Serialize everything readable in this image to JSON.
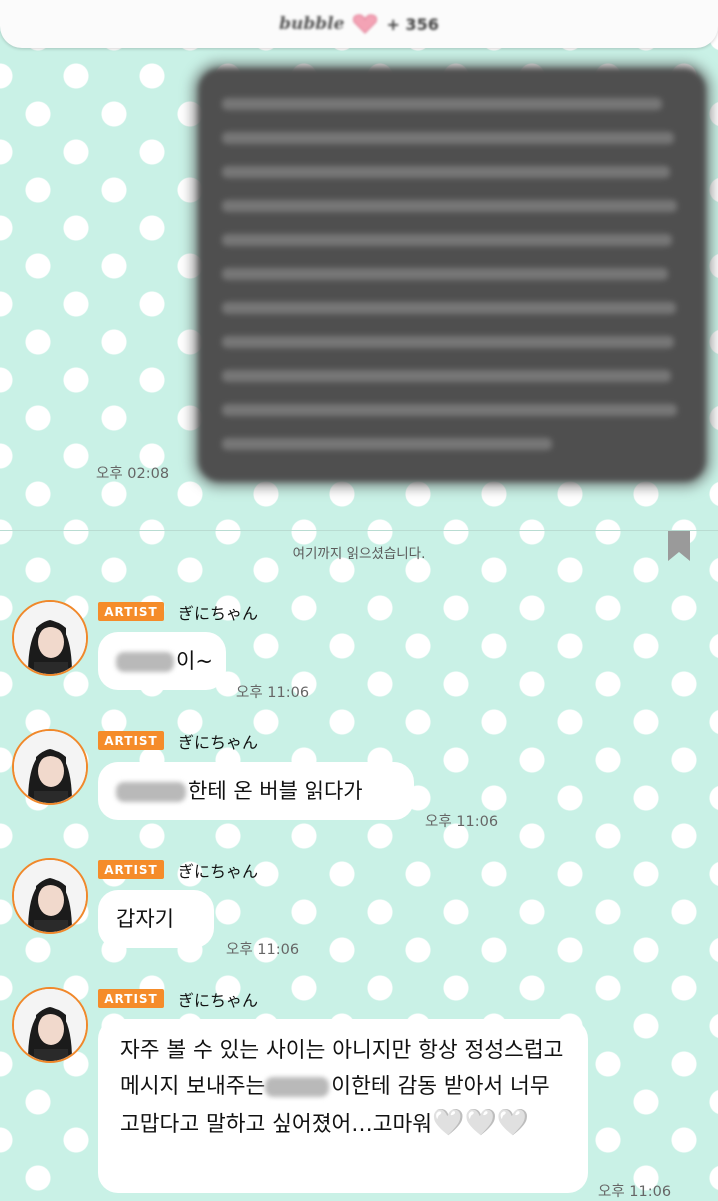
{
  "header": {
    "app_name": "bubble",
    "member_count": "+ 356"
  },
  "sent_message": {
    "time": "오후 02:08"
  },
  "read_marker": "여기까지 읽으셨습니다.",
  "messages": [
    {
      "badge": "ARTIST",
      "sender": "ぎにちゃん",
      "text": "이~",
      "time": "오후 11:06"
    },
    {
      "badge": "ARTIST",
      "sender": "ぎにちゃん",
      "text": "한테 온 버블 읽다가",
      "time": "오후 11:06"
    },
    {
      "badge": "ARTIST",
      "sender": "ぎにちゃん",
      "text": "갑자기",
      "time": "오후 11:06"
    },
    {
      "badge": "ARTIST",
      "sender": "ぎにちゃん",
      "text_part1": "자주 볼 수 있는 사이는 아니지만 항상 정성스럽고 메시지 보내주는",
      "text_part2": "이한테 감동 받아서 너무 고맙다고 말하고 싶어졌어…고마워",
      "hearts": "🤍🤍🤍",
      "time": "오후 11:06"
    }
  ],
  "colors": {
    "background": "#c9f1e6",
    "artist_badge": "#f58c2a",
    "sent_bubble": "#4f4f4f"
  }
}
